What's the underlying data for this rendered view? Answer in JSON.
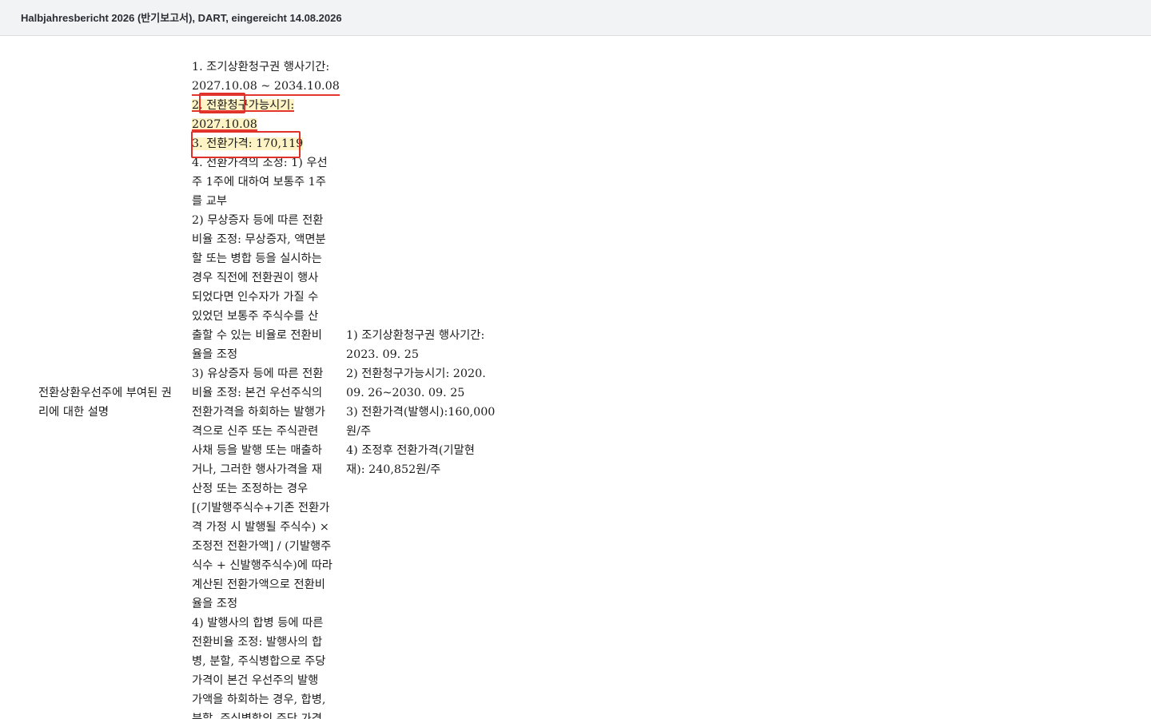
{
  "header": {
    "title": "Halbjahresbericht 2026 (반기보고서), DART, eingereicht 14.08.2026"
  },
  "row": {
    "label_lines": [
      "전환상환우선주에 부여된 권",
      "리에 대한 설명"
    ],
    "current_lines": [
      "1. 조기상환청구권 행사기간:",
      "2027.10.08 ~ 2034.10.08",
      "2. 전환청구가능시기:",
      "2027.10.08",
      "3. 전환가격: 170,119",
      "4. 전환가격의 조정: 1) 우선",
      "주 1주에 대하여 보통주 1주",
      "를 교부",
      "2) 무상증자 등에 따른 전환",
      "비율 조정: 무상증자, 액면분",
      "할 또는 병합 등을 실시하는",
      "경우 직전에 전환권이 행사",
      "되었다면 인수자가 가질 수",
      "있었던 보통주 주식수를 산",
      "출할 수 있는 비율로 전환비",
      "율을 조정",
      "3) 유상증자 등에 따른 전환",
      "비율 조정: 본건 우선주식의",
      "전환가격을 하회하는 발행가",
      "격으로 신주 또는 주식관련",
      "사채 등을 발행 또는 매출하",
      "거나, 그러한 행사가격을 재",
      "산정 또는 조정하는 경우",
      "[(기발행주식수+기존 전환가",
      "격 가정 시 발행될 주식수) ×",
      "조정전 전환가액] / (기발행주",
      "식수 + 신발행주식수)에 따라",
      "계산된 전환가액으로 전환비",
      "율을 조정",
      "4) 발행사의 합병 등에 따른",
      "전환비율 조정: 발행사의 합",
      "병, 분할, 주식병합으로 주당",
      "가격이 본건 우선주의 발행",
      "가액을 하회하는 경우, 합병,",
      "분할, 주식병합의 주당 가격"
    ],
    "prior_lines": [
      "1) 조기상환청구권 행사기간:",
      "2023. 09. 25",
      "2) 전환청구가능시기: 2020.",
      "09. 26~2030. 09. 25",
      "3) 전환가격(발행시):160,000",
      "원/주",
      "4) 조정후 전환가격(기말현",
      "재): 240,852원/주"
    ]
  },
  "colors": {
    "highlight_fill": "#fdf3c4",
    "highlight_border": "#e0302a",
    "header_bg": "#f2f3f4"
  }
}
